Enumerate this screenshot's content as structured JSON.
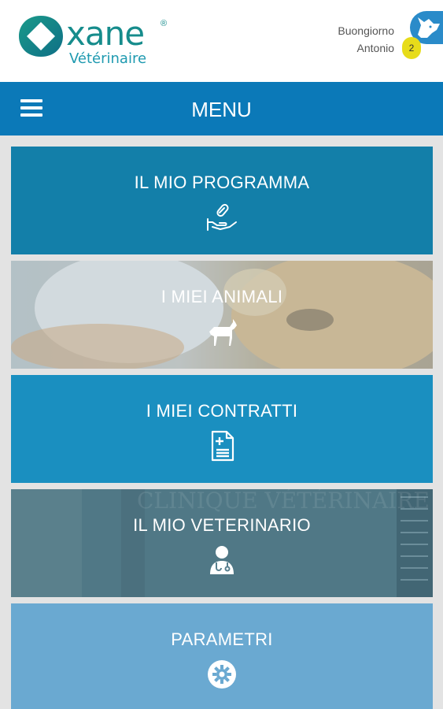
{
  "header": {
    "logo": {
      "wordmark": "xane",
      "registered": "®",
      "subtitle": "Vétérinaire"
    },
    "greeting_line1": "Buongiorno",
    "greeting_line2": "Antonio",
    "notification_count": "2"
  },
  "menubar": {
    "title": "MENU"
  },
  "tiles": [
    {
      "label": "IL MIO PROGRAMMA",
      "icon": "hand-pill-icon"
    },
    {
      "label": "I MIEI ANIMALI",
      "icon": "dog-icon"
    },
    {
      "label": "I MIEI CONTRATTI",
      "icon": "document-icon"
    },
    {
      "label": "IL MIO VETERINARIO",
      "icon": "doctor-icon",
      "watermark": "CLINIQUE VÉTÉRINAIRE"
    },
    {
      "label": "PARAMETRI",
      "icon": "gear-icon"
    }
  ],
  "colors": {
    "menubar": "#0b79b8",
    "tile1": "#137fa9",
    "tile3": "#1a8fc0",
    "tile4": "#58808f",
    "tile5": "#6aa9d1",
    "logo": "#168c8c",
    "badge": "#e7dc1a"
  }
}
